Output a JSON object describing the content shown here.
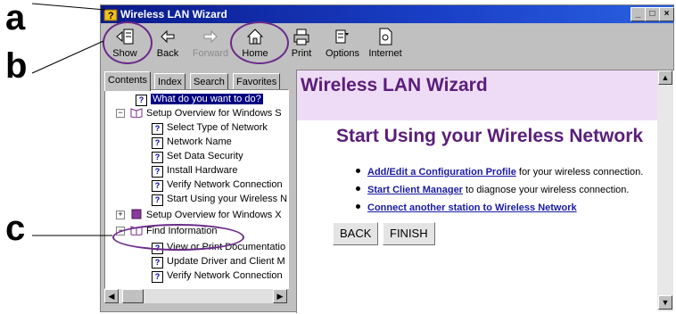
{
  "callouts": {
    "a": "a",
    "b": "b",
    "c": "c"
  },
  "window": {
    "title": "Wireless LAN Wizard",
    "controls": [
      "_",
      "□",
      "×"
    ]
  },
  "toolbar": {
    "show": "Show",
    "back": "Back",
    "forward": "Forward",
    "home": "Home",
    "print": "Print",
    "options": "Options",
    "internet": "Internet"
  },
  "left": {
    "tabs": [
      "Contents",
      "Index",
      "Search",
      "Favorites"
    ],
    "tree": [
      "What do you want to do?",
      "Setup Overview for Windows S",
      "Select Type of Network",
      "Network Name",
      "Set Data Security",
      "Install Hardware",
      "Verify Network Connection",
      "Start Using your Wireless N",
      "Setup Overview for Windows X",
      "Find Information",
      "View or Print Documentatio",
      "Update Driver and Client M",
      "Verify Network Connection"
    ]
  },
  "content": {
    "banner": "Wireless LAN Wizard",
    "heading": "Start Using your Wireless Network",
    "items": [
      {
        "link": "Add/Edit a Configuration Profile",
        "rest": " for your wireless connection."
      },
      {
        "link": "Start Client Manager",
        "rest": " to diagnose your wireless connection."
      },
      {
        "link": "Connect another station to Wireless Network",
        "rest": ""
      }
    ],
    "back_button": "BACK",
    "finish_button": "FINISH"
  },
  "colors": {
    "highlight": "#6a2a8a",
    "heading": "#5a1e7a",
    "banner_bg": "#eedcf6",
    "link": "#1a1aa6"
  }
}
